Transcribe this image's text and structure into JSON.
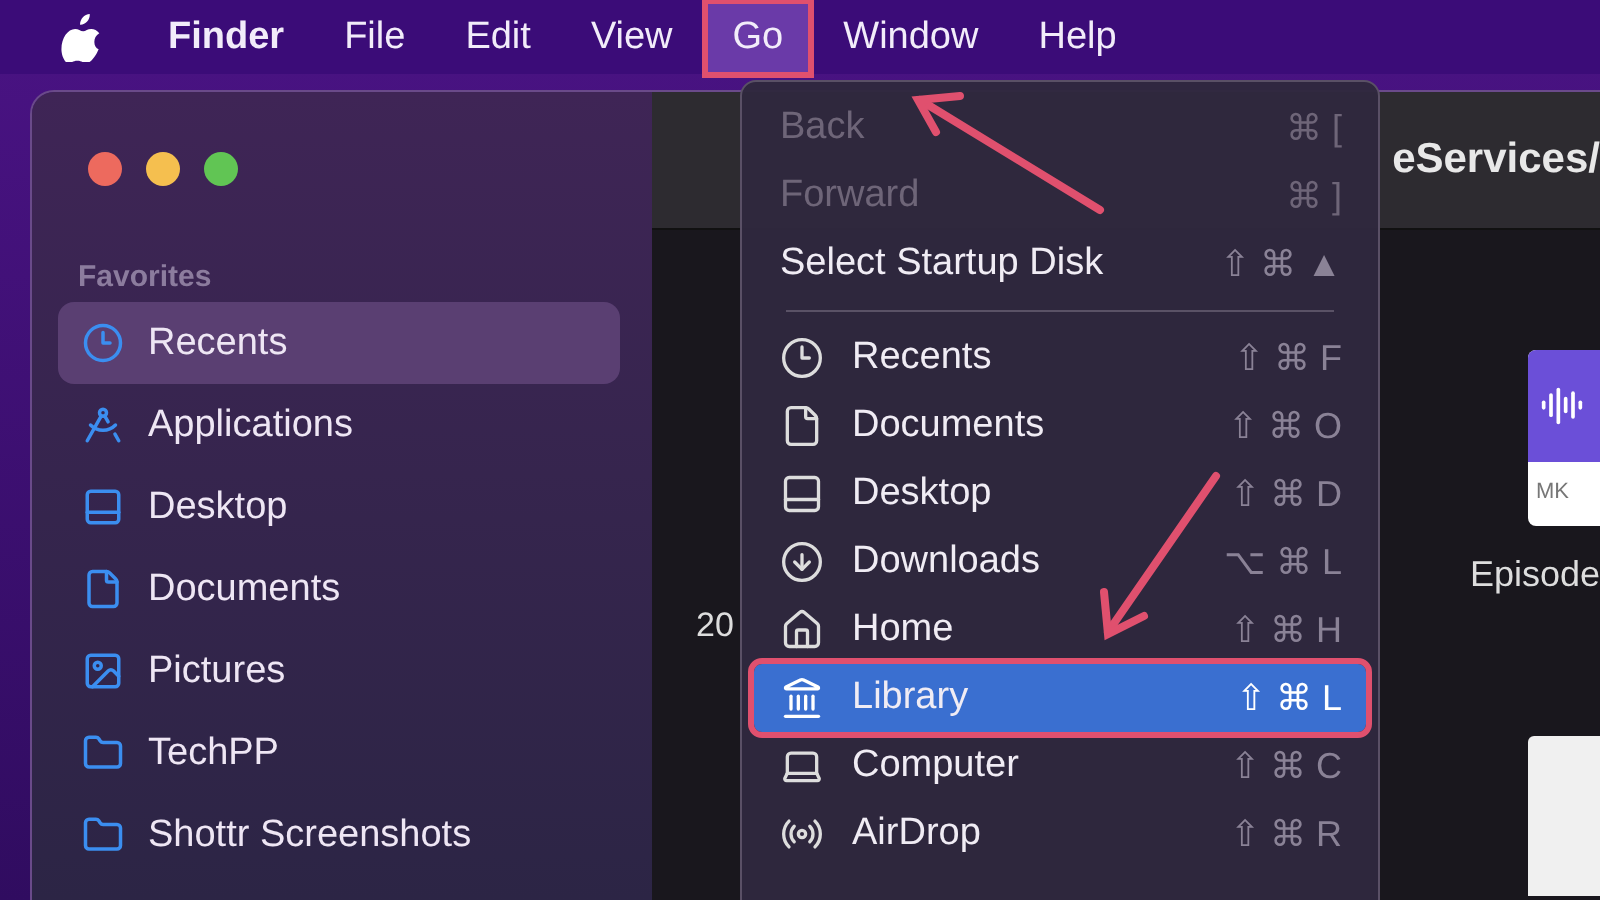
{
  "menubar": {
    "items": [
      {
        "label": "Finder",
        "selected": false,
        "annotated": false
      },
      {
        "label": "File",
        "selected": false,
        "annotated": false
      },
      {
        "label": "Edit",
        "selected": false,
        "annotated": false
      },
      {
        "label": "View",
        "selected": false,
        "annotated": false
      },
      {
        "label": "Go",
        "selected": true,
        "annotated": true
      },
      {
        "label": "Window",
        "selected": false,
        "annotated": false
      },
      {
        "label": "Help",
        "selected": false,
        "annotated": false
      }
    ]
  },
  "sidebar": {
    "heading": "Favorites",
    "items": [
      {
        "label": "Recents",
        "selected": true
      },
      {
        "label": "Applications",
        "selected": false
      },
      {
        "label": "Desktop",
        "selected": false
      },
      {
        "label": "Documents",
        "selected": false
      },
      {
        "label": "Pictures",
        "selected": false
      },
      {
        "label": "TechPP",
        "selected": false
      },
      {
        "label": "Shottr Screenshots",
        "selected": false
      }
    ]
  },
  "toolbar": {
    "path": "eServices/"
  },
  "content": {
    "date_fragment": "20",
    "tile_label": "MK",
    "file_name": "Episode"
  },
  "go_menu": {
    "sections": [
      {
        "items": [
          {
            "label": "Back",
            "shortcut": "⌘ [",
            "disabled": true,
            "selected": false,
            "annotated": false
          },
          {
            "label": "Forward",
            "shortcut": "⌘ ]",
            "disabled": true,
            "selected": false,
            "annotated": false
          },
          {
            "label": "Select Startup Disk",
            "shortcut": "⇧ ⌘ ▲",
            "disabled": false,
            "selected": false,
            "annotated": false
          }
        ]
      },
      {
        "items": [
          {
            "label": "Recents",
            "shortcut": "⇧ ⌘ F",
            "disabled": false,
            "selected": false,
            "annotated": false
          },
          {
            "label": "Documents",
            "shortcut": "⇧ ⌘ O",
            "disabled": false,
            "selected": false,
            "annotated": false
          },
          {
            "label": "Desktop",
            "shortcut": "⇧ ⌘ D",
            "disabled": false,
            "selected": false,
            "annotated": false
          },
          {
            "label": "Downloads",
            "shortcut": "⌥ ⌘ L",
            "disabled": false,
            "selected": false,
            "annotated": false
          },
          {
            "label": "Home",
            "shortcut": "⇧ ⌘ H",
            "disabled": false,
            "selected": false,
            "annotated": false
          },
          {
            "label": "Library",
            "shortcut": "⇧ ⌘ L",
            "disabled": false,
            "selected": true,
            "annotated": true
          },
          {
            "label": "Computer",
            "shortcut": "⇧ ⌘ C",
            "disabled": false,
            "selected": false,
            "annotated": false
          },
          {
            "label": "AirDrop",
            "shortcut": "⇧ ⌘ R",
            "disabled": false,
            "selected": false,
            "annotated": false
          }
        ]
      }
    ]
  }
}
